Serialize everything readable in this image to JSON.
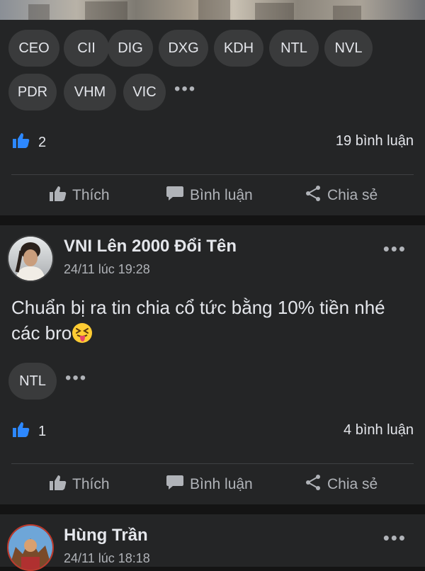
{
  "post1": {
    "tags": [
      "CEO",
      "CII",
      "DIG",
      "DXG",
      "KDH",
      "NTL",
      "NVL",
      "PDR",
      "VHM",
      "VIC"
    ],
    "likes": "2",
    "comments": "19 bình luận"
  },
  "actions": {
    "like": "Thích",
    "comment": "Bình luận",
    "share": "Chia sẻ"
  },
  "post2": {
    "author": "VNI Lên 2000 Đổi Tên",
    "time": "24/11 lúc 19:28",
    "text": "Chuẩn bị ra tin chia cổ tức bằng 10% tiền nhé các bro",
    "emoji": "squinting-tongue-face",
    "tags": [
      "NTL"
    ],
    "likes": "1",
    "comments": "4 bình luận"
  },
  "post3": {
    "author": "Hùng Trần",
    "time": "24/11 lúc 18:18"
  },
  "colors": {
    "background": "#141414",
    "card": "#242526",
    "pill": "#3a3b3c",
    "like_blue": "#2d88ff",
    "secondary_text": "#b0b3b8"
  },
  "icons": {
    "like_reaction": "thumbs-up-icon",
    "like_action": "thumbs-up-outline-icon",
    "comment": "speech-bubble-icon",
    "share": "share-icon",
    "more": "more-horizontal-icon"
  }
}
